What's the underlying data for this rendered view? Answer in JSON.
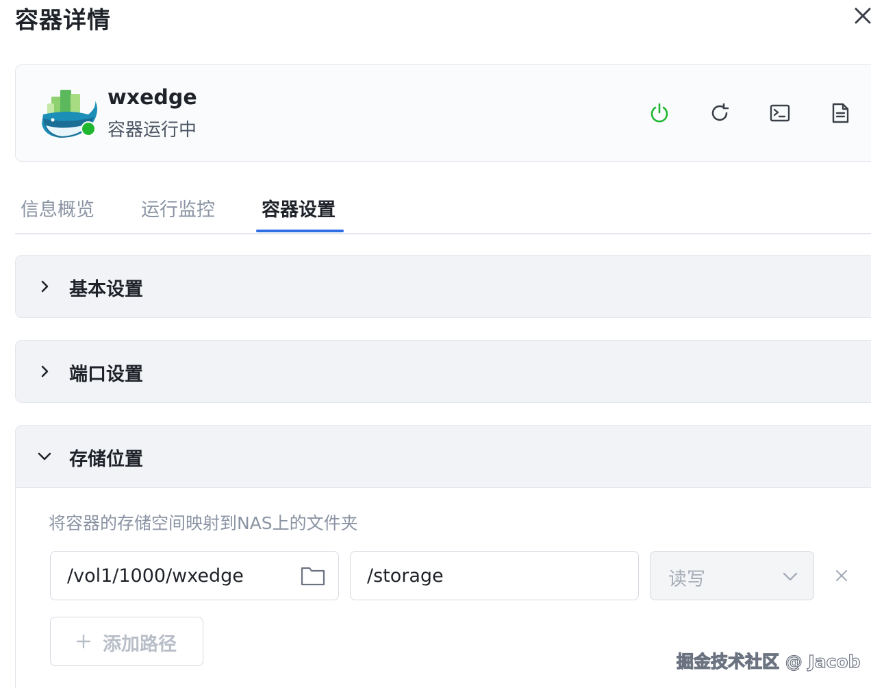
{
  "dialog": {
    "title": "容器详情"
  },
  "container": {
    "name": "wxedge",
    "status": "容器运行中",
    "status_color": "#1fb72f"
  },
  "actions": [
    {
      "name": "power-icon",
      "color": "#1fb72f"
    },
    {
      "name": "restart-icon",
      "color": "#4b5563"
    },
    {
      "name": "terminal-icon",
      "color": "#4b5563"
    },
    {
      "name": "log-file-icon",
      "color": "#4b5563"
    }
  ],
  "tabs": [
    {
      "label": "信息概览"
    },
    {
      "label": "运行监控"
    },
    {
      "label": "容器设置",
      "active": true
    }
  ],
  "sections": [
    {
      "title": "基本设置",
      "expanded": false
    },
    {
      "title": "端口设置",
      "expanded": false
    },
    {
      "title": "存储位置",
      "expanded": true
    }
  ],
  "storage": {
    "description": "将容器的存储空间映射到NAS上的文件夹",
    "rows": [
      {
        "host_path": "/vol1/1000/wxedge",
        "container_path": "/storage",
        "mode": "读写"
      }
    ],
    "add_label": "添加路径"
  },
  "watermark": "掘金技术社区 @ Jacob",
  "colors": {
    "accent": "#2f6fe4",
    "running": "#1fb72f"
  }
}
